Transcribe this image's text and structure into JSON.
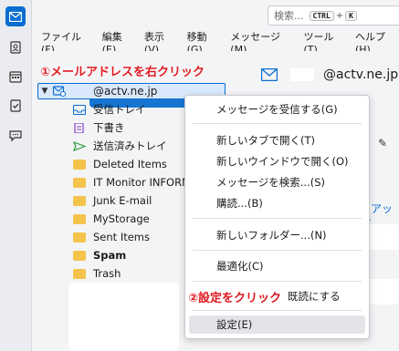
{
  "search": {
    "placeholder": "検索...",
    "key1": "CTRL",
    "key2": "K"
  },
  "menubar": {
    "items": [
      "ファイル(F)",
      "編集(E)",
      "表示(V)",
      "移動(G)",
      "メッセージ(M)",
      "ツール(T)",
      "ヘルプ(H)"
    ]
  },
  "annotations": {
    "step1": "①メールアドレスを右クリック",
    "step2": "②設定をクリック"
  },
  "account": {
    "label": "@actv.ne.jp"
  },
  "folders": [
    "受信トレイ",
    "下書き",
    "送信済みトレイ",
    "Deleted Items",
    "IT Monitor INFORM",
    "Junk E-mail",
    "MyStorage",
    "Sent Items",
    "Spam",
    "Trash"
  ],
  "header": {
    "account_email": "@actv.ne.jp"
  },
  "rightpane": {
    "setup_text": "トアップ"
  },
  "context_menu": {
    "items": [
      "メッセージを受信する(G)",
      "新しいタブで開く(T)",
      "新しいウインドウで開く(O)",
      "メッセージを検索...(S)",
      "購読...(B)",
      "新しいフォルダー...(N)",
      "最適化(C)",
      "既読にする",
      "設定(E)"
    ]
  },
  "colors": {
    "accent": "#0a6ed1",
    "annotation": "#e0191f"
  }
}
